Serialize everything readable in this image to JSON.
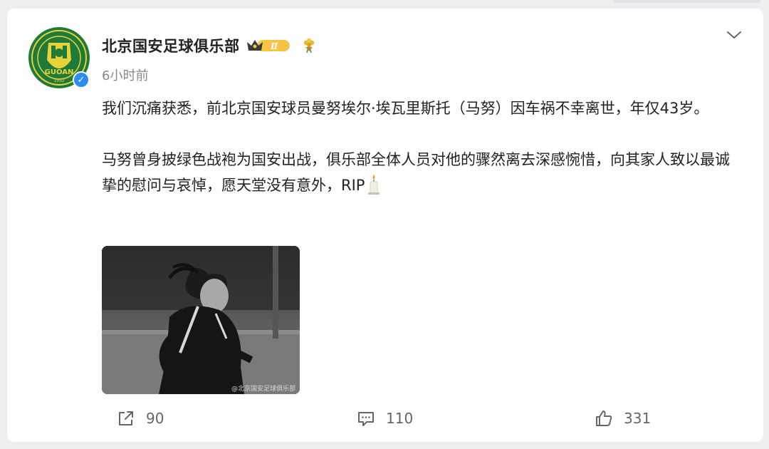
{
  "post": {
    "author": {
      "name": "北京国安足球俱乐部",
      "avatar_text": "GUOAN",
      "avatar_year": "1992",
      "vip_level": "Ⅱ"
    },
    "timestamp": "6小时前",
    "paragraphs": [
      "我们沉痛获悉，前北京国安球员曼努埃尔·埃瓦里斯托（马努）因车祸不幸离世，年仅43岁。",
      "马努曾身披绿色战袍为国安出战，俱乐部全体人员对他的骤然离去深感惋惜，向其家人致以最诚挚的慰问与哀悼，愿天堂没有意外，RIP"
    ],
    "image": {
      "watermark": "@北京国安足球俱乐部"
    },
    "stats": {
      "reposts": "90",
      "comments": "110",
      "likes": "331"
    }
  },
  "colors": {
    "club_green": "#1f7a3a",
    "club_yellow": "#e8d23a",
    "verify_blue": "#2f8bf0",
    "background": "#eeeef1"
  },
  "icons": [
    "club-logo-icon",
    "verified-icon",
    "vip-crown-icon",
    "flower-icon",
    "chevron-down-icon",
    "candle-icon",
    "repost-icon",
    "comment-icon",
    "like-icon"
  ]
}
